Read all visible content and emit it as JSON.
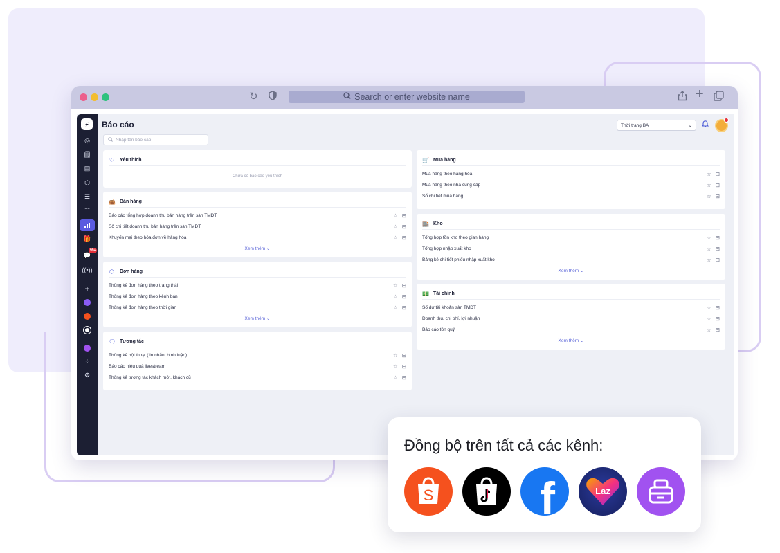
{
  "browser": {
    "url_placeholder": "Search or enter website name"
  },
  "app": {
    "page_title": "Báo cáo",
    "search_placeholder": "Nhập tên báo cáo",
    "store_selector": "Thời trang BA",
    "rail_badge": "99+"
  },
  "sections": {
    "favorites": {
      "title": "Yêu thích",
      "empty_text": "Chưa có báo cáo yêu thích"
    },
    "sales": {
      "title": "Bán hàng",
      "items": [
        "Báo cáo tổng hợp doanh thu bán hàng trên sàn TMĐT",
        "Sổ chi tiết doanh thu bán hàng trên sàn TMĐT",
        "Khuyến mại theo hóa đơn về hàng hóa"
      ],
      "more": "Xem thêm"
    },
    "orders": {
      "title": "Đơn hàng",
      "items": [
        "Thống kê đơn hàng theo trạng thái",
        "Thống kê đơn hàng theo kênh bán",
        "Thống kê đơn hàng theo thời gian"
      ],
      "more": "Xem thêm"
    },
    "interaction": {
      "title": "Tương tác",
      "items": [
        "Thống kê hội thoại (tin nhắn, bình luận)",
        "Báo cáo hiệu quả livestream",
        "Thống kê tương tác khách mới, khách cũ"
      ]
    },
    "purchase": {
      "title": "Mua hàng",
      "items": [
        "Mua hàng theo hàng hóa",
        "Mua hàng theo nhà cung cấp",
        "Sổ chi tiết mua hàng"
      ]
    },
    "warehouse": {
      "title": "Kho",
      "items": [
        "Tổng hợp tồn kho theo gian hàng",
        "Tổng hợp nhập xuất kho",
        "Bảng kê chi tiết phiếu nhập xuất kho"
      ],
      "more": "Xem thêm"
    },
    "finance": {
      "title": "Tài chính",
      "items": [
        "Số dư tài khoản sàn TMĐT",
        "Doanh thu, chi phí, lợi nhuận",
        "Báo cáo tồn quỹ"
      ],
      "more": "Xem thêm"
    }
  },
  "channels": {
    "title": "Đồng bộ trên tất cả các kênh:",
    "lazada_label": "Laz",
    "shopee_label": "S",
    "facebook_label": "f",
    "colors": {
      "shopee": "#f5511e",
      "tiktok": "#000000",
      "facebook": "#1877f2",
      "lazada": "#1d2a7a",
      "other": "#a152f0"
    }
  }
}
